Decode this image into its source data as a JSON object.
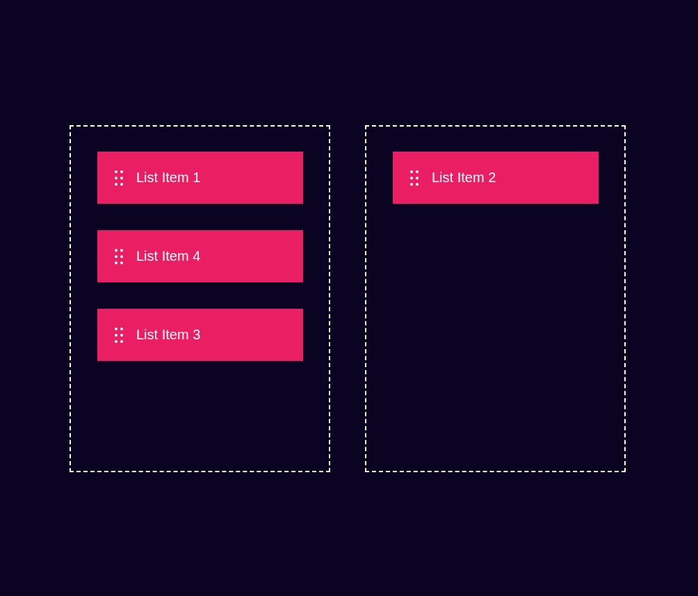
{
  "columns": [
    {
      "items": [
        {
          "label": "List Item 1"
        },
        {
          "label": "List Item 4"
        },
        {
          "label": "List Item 3"
        }
      ]
    },
    {
      "items": [
        {
          "label": "List Item 2"
        }
      ]
    }
  ]
}
